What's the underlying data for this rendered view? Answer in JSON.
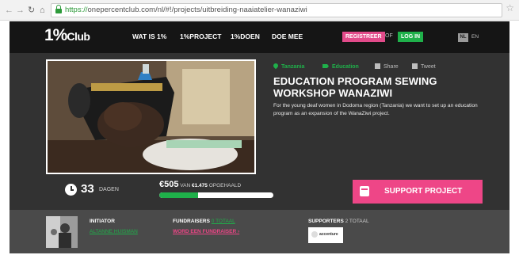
{
  "browser": {
    "url_scheme": "https://",
    "url_rest": "onepercentclub.com/nl/#!/projects/uitbreiding-naaiatelier-wanaziwi"
  },
  "header": {
    "logo_big": "1%",
    "logo_small": "Club",
    "nav": [
      "WAT IS 1%",
      "1%PROJECT",
      "1%DOEN",
      "DOE MEE"
    ],
    "register_label": "REGISTREER",
    "or_label": "OF",
    "login_label": "LOG IN",
    "lang_active": "NL",
    "lang_other": "EN"
  },
  "project": {
    "location": "Tanzania",
    "theme": "Education",
    "share_label": "Share",
    "tweet_label": "Tweet",
    "title": "EDUCATION PROGRAM SEWING WORKSHOP WANAZIWI",
    "description": "For the young deaf women in Dodoma region (Tanzania) we want to set up an education program as an expansion of the WanaZiwi project.",
    "days_count": "33",
    "days_label": "DAGEN",
    "raised": "€505",
    "of_label": "VAN",
    "target": "€1.475",
    "raised_suffix": "OPGEHAALD",
    "progress_fraction": 0.342,
    "support_label": "SUPPORT PROJECT"
  },
  "info": {
    "initiator_label": "INITIATOR",
    "initiator_name": "ALTANNE HUISMAN",
    "fundraisers_label": "FUNDRAISERS",
    "fundraisers_count": "0 TOTAAL",
    "fundraiser_link": "WORD EEN FUNDRAISER ›",
    "supporters_label": "SUPPORTERS",
    "supporters_count": "2 TOTAAL",
    "supporter_logo_text": "accenture"
  },
  "colors": {
    "accent_green": "#1fb04a",
    "accent_pink": "#ee4687",
    "header_bg": "#151515",
    "project_bg": "#323232"
  },
  "icons": {
    "location": "map-pin-icon",
    "theme": "tag-icon",
    "share": "share-icon",
    "tweet": "tweet-icon",
    "days": "clock-icon",
    "support": "wallet-icon"
  }
}
